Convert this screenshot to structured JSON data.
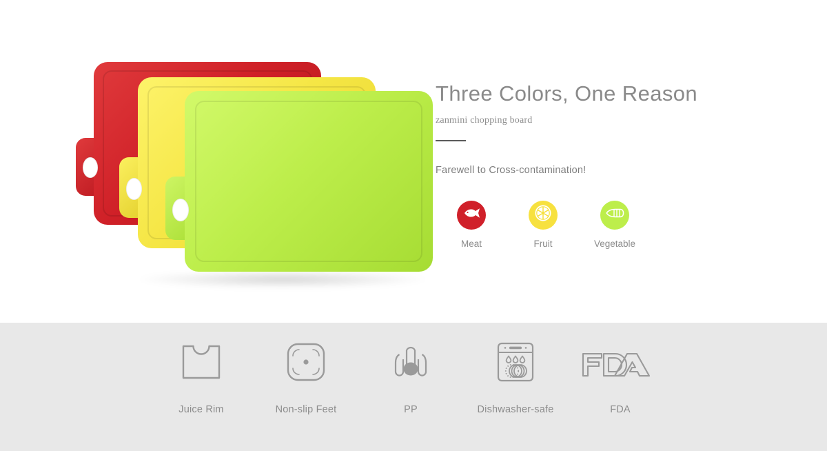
{
  "hero": {
    "headline": "Three Colors, One Reason",
    "subhead": "zanmini chopping board",
    "tagline": "Farewell to Cross-contamination!",
    "usecases": [
      {
        "label": "Meat",
        "icon": "fish-icon",
        "color": "#D0202A"
      },
      {
        "label": "Fruit",
        "icon": "lemon-icon",
        "color": "#F7E13F"
      },
      {
        "label": "Vegetable",
        "icon": "vegetable-icon",
        "color": "#BDEE4B"
      }
    ]
  },
  "product": {
    "boards": [
      {
        "name": "red-board",
        "color": "#CF2027"
      },
      {
        "name": "yellow-board",
        "color": "#F5E645"
      },
      {
        "name": "green-board",
        "color": "#BDEE4B"
      }
    ]
  },
  "features": [
    {
      "label": "Juice Rim",
      "icon": "juice-rim-icon"
    },
    {
      "label": "Non-slip Feet",
      "icon": "non-slip-feet-icon"
    },
    {
      "label": "PP",
      "icon": "pp-material-icon"
    },
    {
      "label": "Dishwasher-safe",
      "icon": "dishwasher-icon"
    },
    {
      "label": "FDA",
      "icon": "fda-logo-icon"
    }
  ],
  "colors": {
    "background": "#FFFFFF",
    "feature_band": "#E8E8E8",
    "text_gray": "#8A8A8A",
    "rule": "#5A5A5A"
  }
}
